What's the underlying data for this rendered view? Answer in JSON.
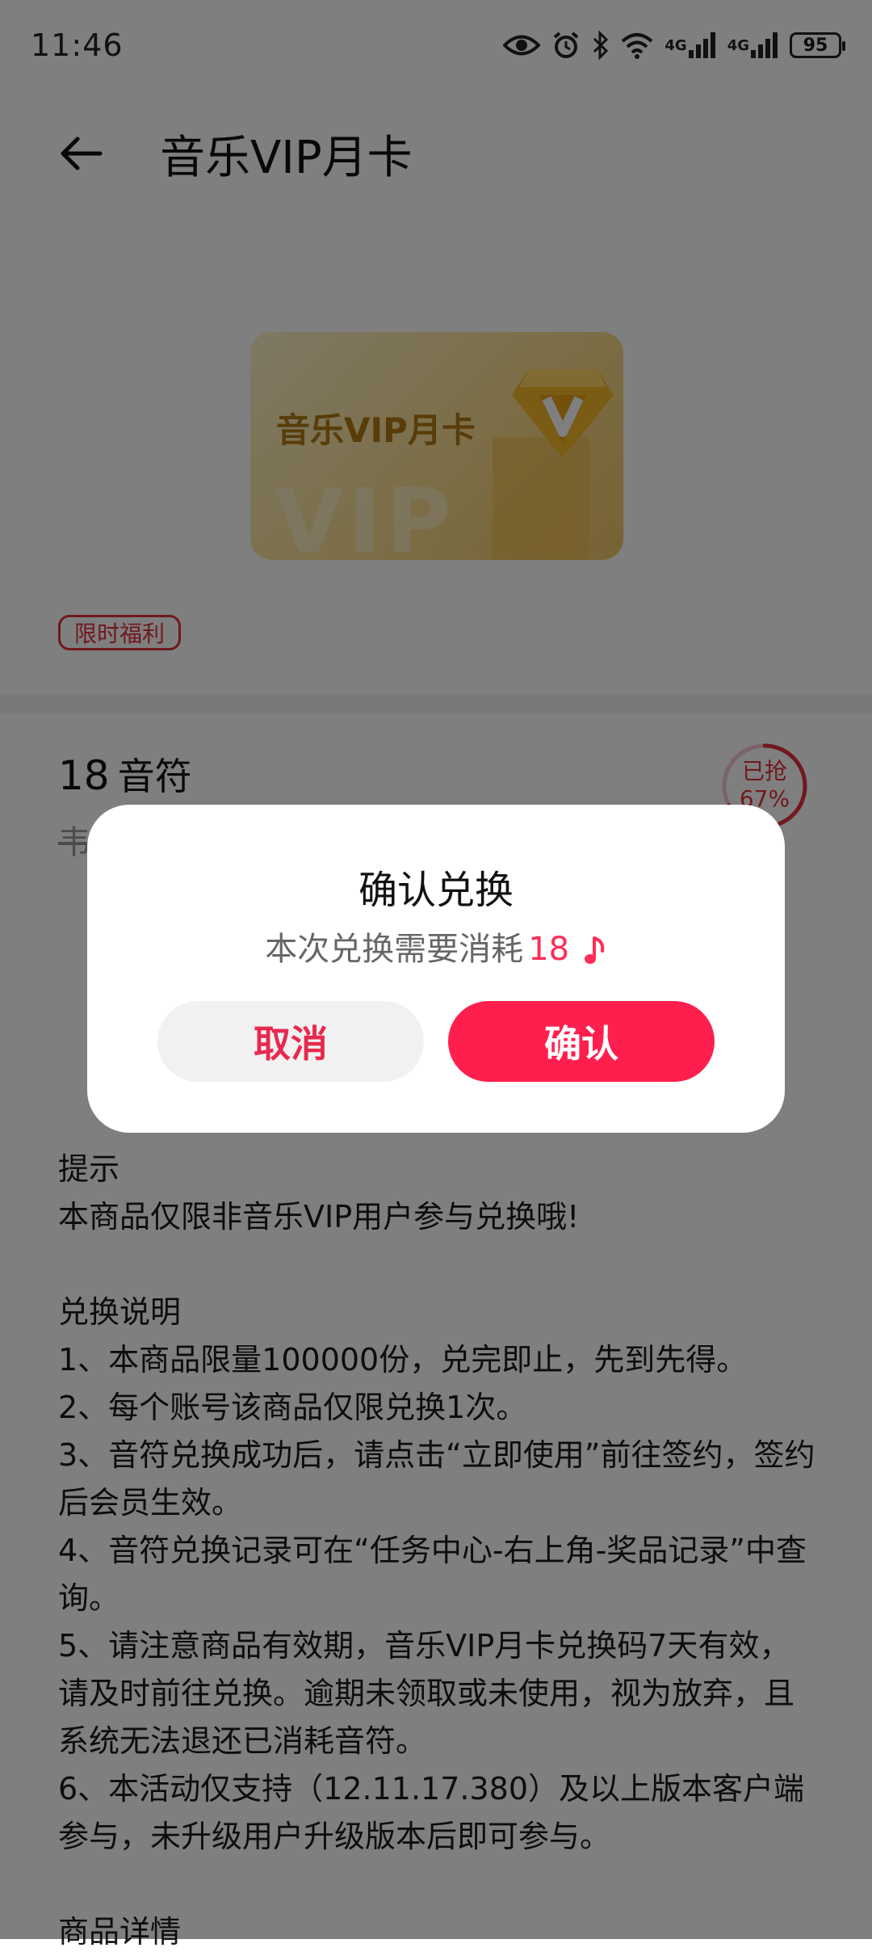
{
  "status_bar": {
    "time": "11:46",
    "battery": "95",
    "icons": [
      "eye-icon",
      "alarm-icon",
      "bluetooth-icon",
      "wifi-icon",
      "signal-4g-icon",
      "signal-4g-icon",
      "battery-icon"
    ],
    "network_label_1": "4G",
    "network_label_2": "4G"
  },
  "header": {
    "title": "音乐VIP月卡"
  },
  "product": {
    "card_title": "音乐VIP月卡",
    "card_watermark": "VIP",
    "badge": "限时福利",
    "price_value": "18",
    "price_unit": "音符",
    "old_price": "韦",
    "grabbed_label": "已抢",
    "grabbed_percent": "67%",
    "grabbed_fraction": 0.67
  },
  "description": {
    "tip_heading": "提示",
    "tip_text": "本商品仅限非音乐VIP用户参与兑换哦!",
    "rules_heading": "兑换说明",
    "rules": [
      "1、本商品限量100000份，兑完即止，先到先得。",
      "2、每个账号该商品仅限兑换1次。",
      "3、音符兑换成功后，请点击“立即使用”前往签约，签约后会员生效。",
      "4、音符兑换记录可在“任务中心-右上角-奖品记录”中查询。",
      "5、请注意商品有效期，音乐VIP月卡兑换码7天有效，请及时前往兑换。逾期未领取或未使用，视为放弃，且系统无法退还已消耗音符。",
      "6、本活动仅支持（12.11.17.380）及以上版本客户端参与，未升级用户升级版本后即可参与。"
    ],
    "details_heading": "商品详情"
  },
  "dialog": {
    "title": "确认兑换",
    "message": "本次兑换需要消耗",
    "amount": "18",
    "cancel_label": "取消",
    "confirm_label": "确认"
  },
  "colors": {
    "accent": "#ff1f4e",
    "badge_red": "#e0323c",
    "card_gold": "#f8dc8e",
    "overlay": "rgba(0,0,0,0.5)"
  }
}
